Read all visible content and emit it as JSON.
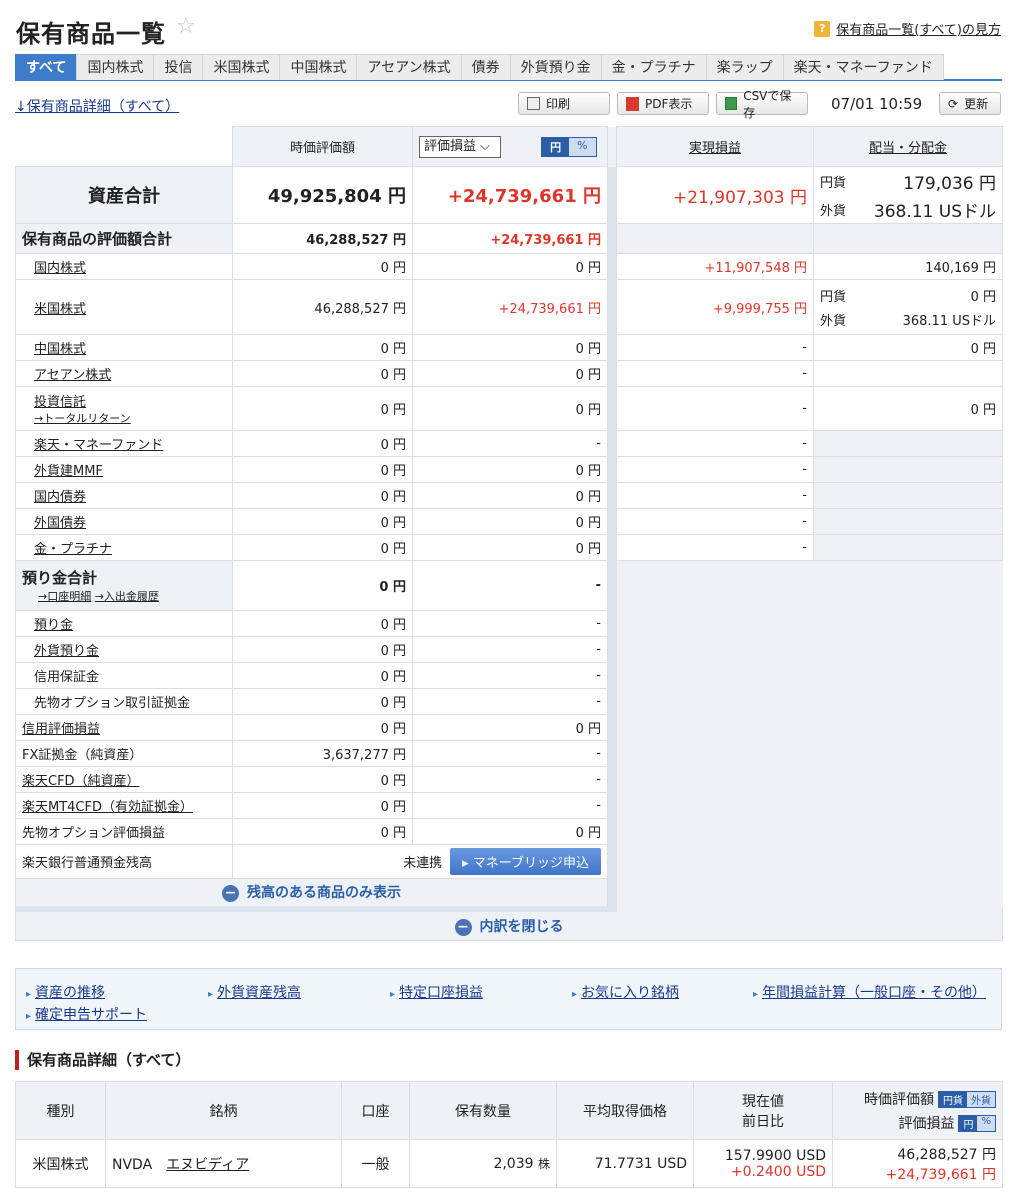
{
  "header": {
    "title": "保有商品一覧",
    "help": "保有商品一覧(すべて)の見方"
  },
  "tabs": [
    "すべて",
    "国内株式",
    "投信",
    "米国株式",
    "中国株式",
    "アセアン株式",
    "債券",
    "外貨預り金",
    "金・プラチナ",
    "楽ラップ",
    "楽天・マネーファンド"
  ],
  "toolbar": {
    "detail_link": "↓保有商品詳細（すべて）",
    "print": "印刷",
    "pdf": "PDF表示",
    "csv": "CSVで保存",
    "timestamp": "07/01 10:59",
    "refresh": "更新"
  },
  "table": {
    "h_value": "時価評価額",
    "h_select": "評価損益",
    "h_yen": "円",
    "h_pct": "%",
    "h_realized": "実現損益",
    "h_dividend": "配当・分配金",
    "total": {
      "label": "資産合計",
      "value": "49,925,804 円",
      "pl": "+24,739,661 円",
      "realized": "+21,907,303 円",
      "div_jpy_label": "円貨",
      "div_jpy": "179,036 円",
      "div_fx_label": "外貨",
      "div_fx": "368.11 USドル"
    },
    "holdings": {
      "label": "保有商品の評価額合計",
      "value": "46,288,527 円",
      "pl": "+24,739,661 円"
    },
    "rows": {
      "domestic": {
        "label": "国内株式",
        "value": "0 円",
        "pl": "0 円",
        "realized": "+11,907,548 円",
        "div": "140,169 円"
      },
      "us": {
        "label": "米国株式",
        "value": "46,288,527 円",
        "pl": "+24,739,661 円",
        "realized": "+9,999,755 円",
        "div_jpy_label": "円貨",
        "div_jpy": "0 円",
        "div_fx_label": "外貨",
        "div_fx": "368.11 USドル"
      },
      "china": {
        "label": "中国株式",
        "value": "0 円",
        "pl": "0 円",
        "realized": "-",
        "div": "0 円"
      },
      "asean": {
        "label": "アセアン株式",
        "value": "0 円",
        "pl": "0 円",
        "realized": "-"
      },
      "fund": {
        "label": "投資信託",
        "sub": "→トータルリターン",
        "value": "0 円",
        "pl": "0 円",
        "realized": "-",
        "div": "0 円"
      },
      "moneyfund": {
        "label": "楽天・マネーファンド",
        "value": "0 円",
        "pl": "-",
        "realized": "-"
      },
      "mmf": {
        "label": "外貨建MMF",
        "value": "0 円",
        "pl": "0 円",
        "realized": "-"
      },
      "dbond": {
        "label": "国内債券",
        "value": "0 円",
        "pl": "0 円",
        "realized": "-"
      },
      "fbond": {
        "label": "外国債券",
        "value": "0 円",
        "pl": "0 円",
        "realized": "-"
      },
      "gold": {
        "label": "金・プラチナ",
        "value": "0 円",
        "pl": "0 円",
        "realized": "-"
      }
    },
    "deposit": {
      "label": "預り金合計",
      "sub1": "→口座明細",
      "sub2": "→入出金履歴",
      "value": "0 円",
      "pl": "-"
    },
    "dep_rows": {
      "d1": {
        "label": "預り金",
        "value": "0 円",
        "pl": "-"
      },
      "d2": {
        "label": "外貨預り金",
        "value": "0 円",
        "pl": "-"
      },
      "d3": {
        "label": "信用保証金",
        "value": "0 円",
        "pl": "-"
      },
      "d4": {
        "label": "先物オプション取引証拠金",
        "value": "0 円",
        "pl": "-"
      }
    },
    "other_rows": {
      "o1": {
        "label": "信用評価損益",
        "value": "0 円",
        "pl": "0 円"
      },
      "o2": {
        "label": "FX証拠金（純資産）",
        "value": "3,637,277 円",
        "pl": "-"
      },
      "o3": {
        "label": "楽天CFD（純資産）",
        "value": "0 円",
        "pl": "-"
      },
      "o4": {
        "label": "楽天MT4CFD（有効証拠金）",
        "value": "0 円",
        "pl": "-"
      },
      "o5": {
        "label": "先物オプション評価損益",
        "value": "0 円",
        "pl": "0 円"
      }
    },
    "bank": {
      "label": "楽天銀行普通預金残高",
      "status": "未連携",
      "button": "マネーブリッジ申込"
    },
    "show_balance": "残高のある商品のみ表示",
    "close": "内訳を閉じる"
  },
  "links": [
    "資産の推移",
    "外貨資産残高",
    "特定口座損益",
    "お気に入り銘柄",
    "年間損益計算（一般口座・その他）",
    "確定申告サポート"
  ],
  "detail": {
    "title": "保有商品詳細（すべて）",
    "h": {
      "type": "種別",
      "name": "銘柄",
      "account": "口座",
      "qty": "保有数量",
      "avg": "平均取得価格",
      "price1": "現在値",
      "price2": "前日比",
      "val": "時価評価額",
      "pl": "評価損益",
      "jpy": "円貨",
      "fx": "外貨",
      "yen": "円",
      "pct": "%"
    },
    "row": {
      "type": "米国株式",
      "ticker": "NVDA",
      "name": "エヌビディア",
      "account": "一般",
      "qty": "2,039",
      "qty_unit": "株",
      "avg": "71.7731 USD",
      "price": "157.9900 USD",
      "change": "+0.2400 USD",
      "val": "46,288,527 円",
      "pl": "+24,739,661 円"
    }
  }
}
